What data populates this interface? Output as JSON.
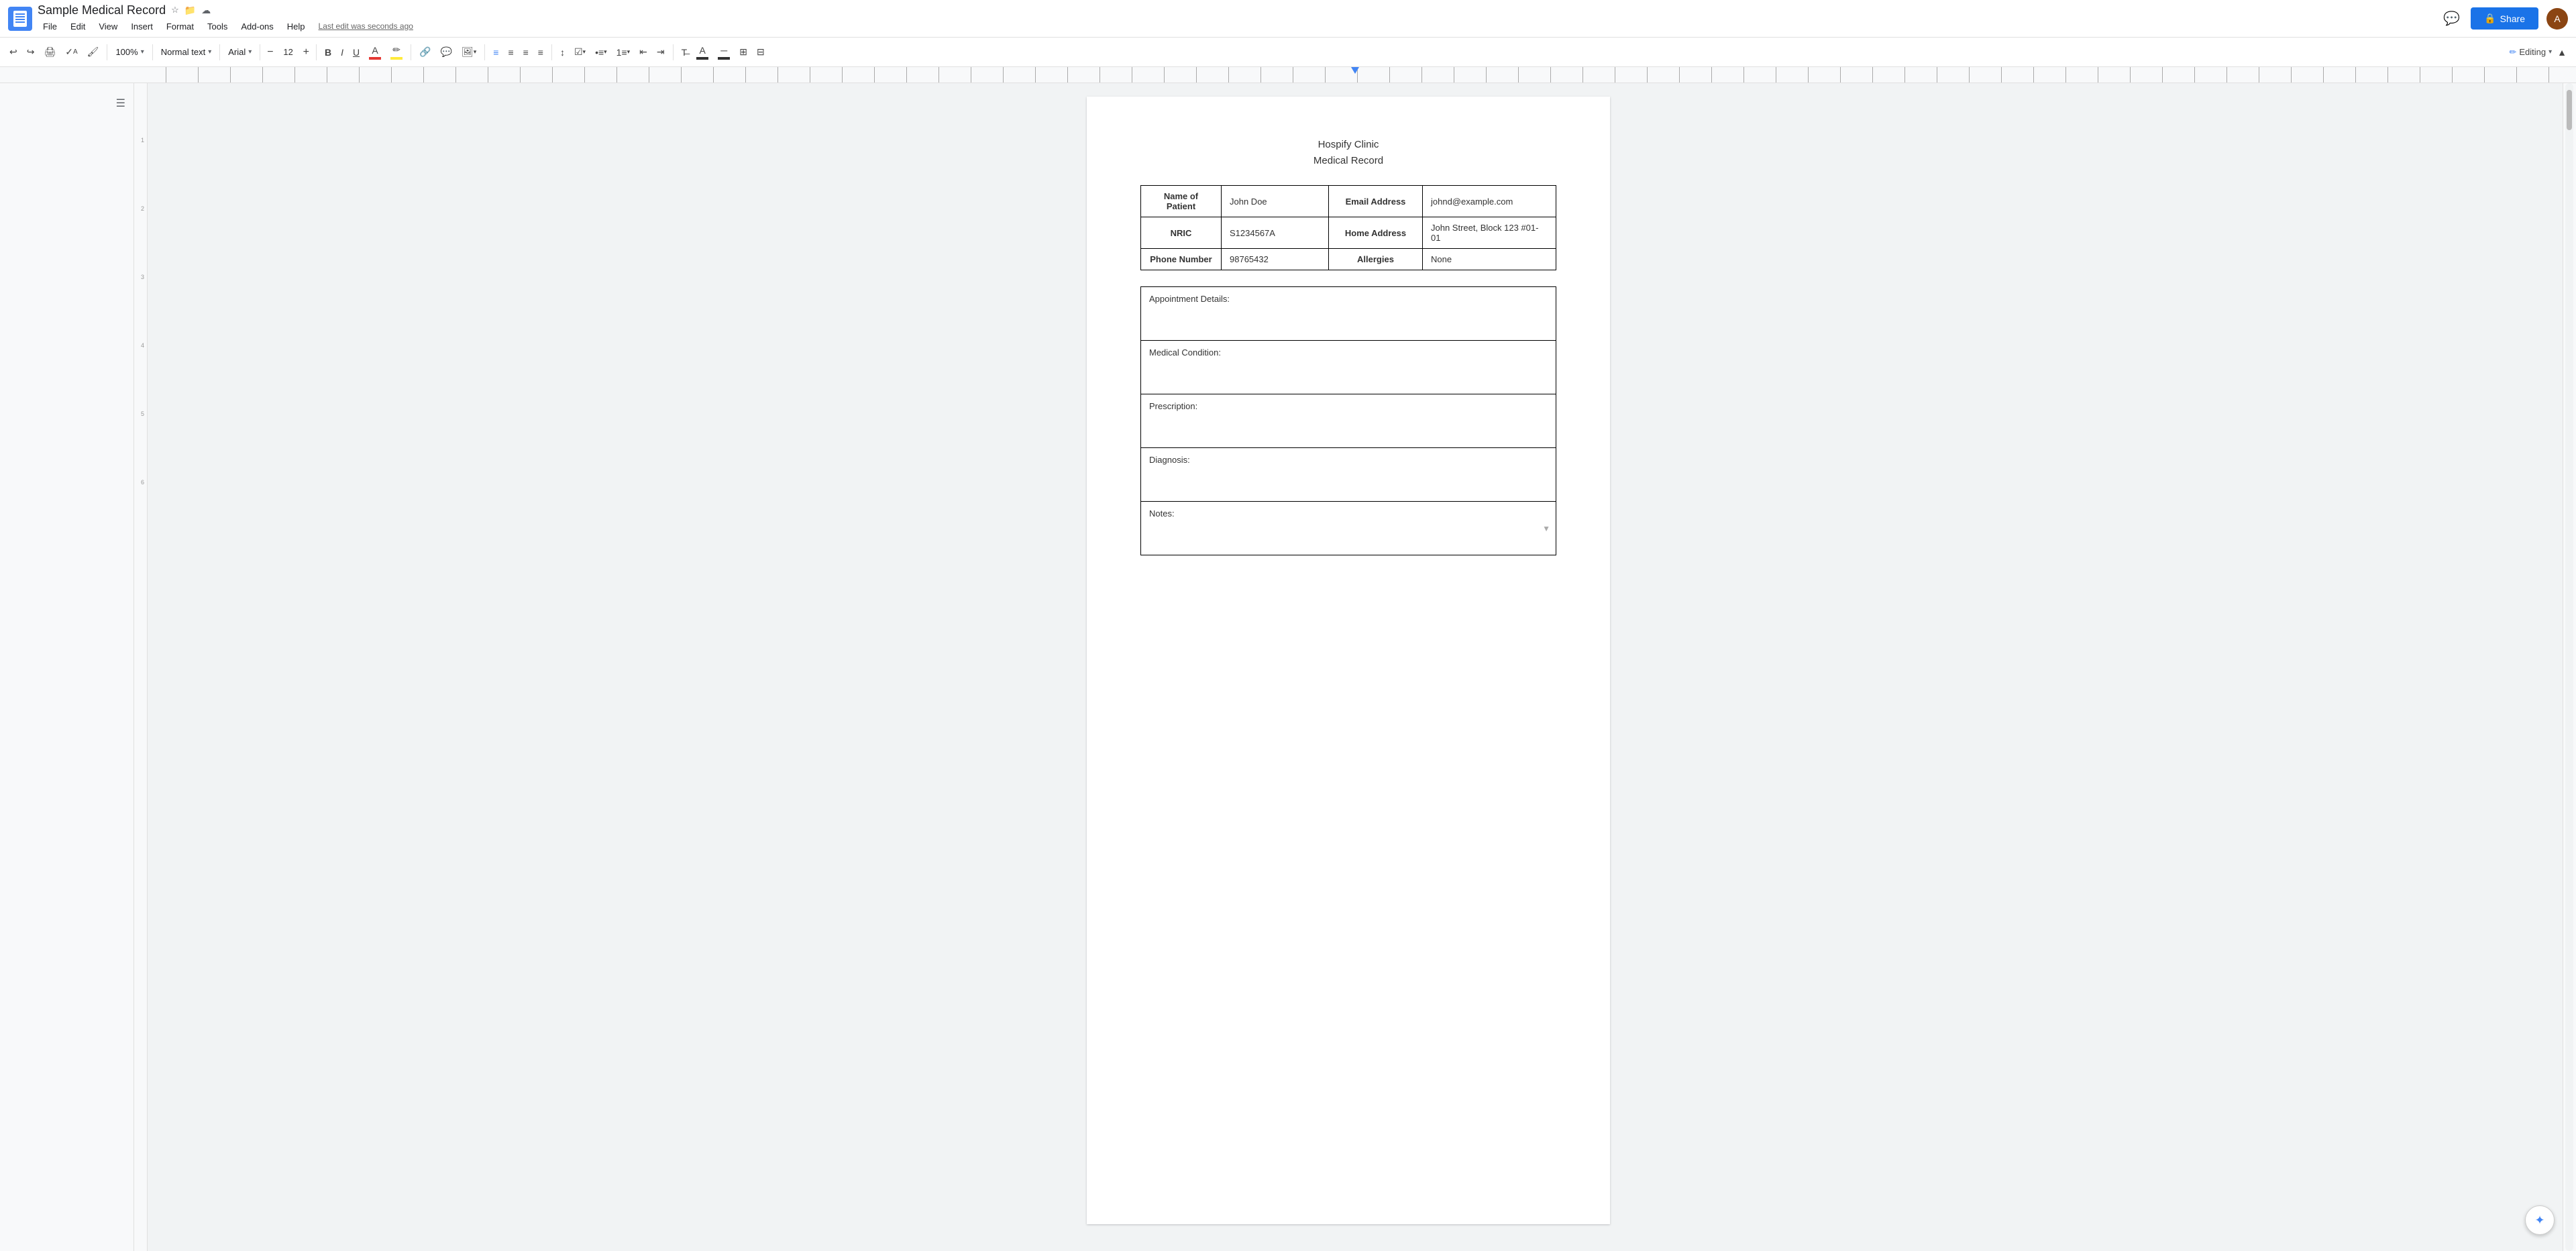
{
  "window": {
    "title": "Sample Medical Record",
    "last_edit": "Last edit was seconds ago"
  },
  "menu": {
    "file": "File",
    "edit": "Edit",
    "view": "View",
    "insert": "Insert",
    "format": "Format",
    "tools": "Tools",
    "addons": "Add-ons",
    "help": "Help"
  },
  "toolbar": {
    "zoom": "100%",
    "style": "Normal text",
    "font": "Arial",
    "font_size": "12",
    "bold": "B",
    "italic": "I",
    "underline": "U",
    "editing_label": "Editing"
  },
  "share_button": "Share",
  "document": {
    "clinic_name": "Hospify Clinic",
    "record_title": "Medical Record",
    "patient_table": {
      "rows": [
        {
          "label1": "Name of Patient",
          "value1": "John Doe",
          "label2": "Email Address",
          "value2": "johnd@example.com"
        },
        {
          "label1": "NRIC",
          "value1": "S1234567A",
          "label2": "Home Address",
          "value2": "John Street, Block 123 #01-01"
        },
        {
          "label1": "Phone Number",
          "value1": "98765432",
          "label2": "Allergies",
          "value2": "None"
        }
      ]
    },
    "details_sections": [
      {
        "label": "Appointment Details:"
      },
      {
        "label": "Medical Condition:"
      },
      {
        "label": "Prescription:"
      },
      {
        "label": "Diagnosis:"
      },
      {
        "label": "Notes:"
      }
    ]
  }
}
